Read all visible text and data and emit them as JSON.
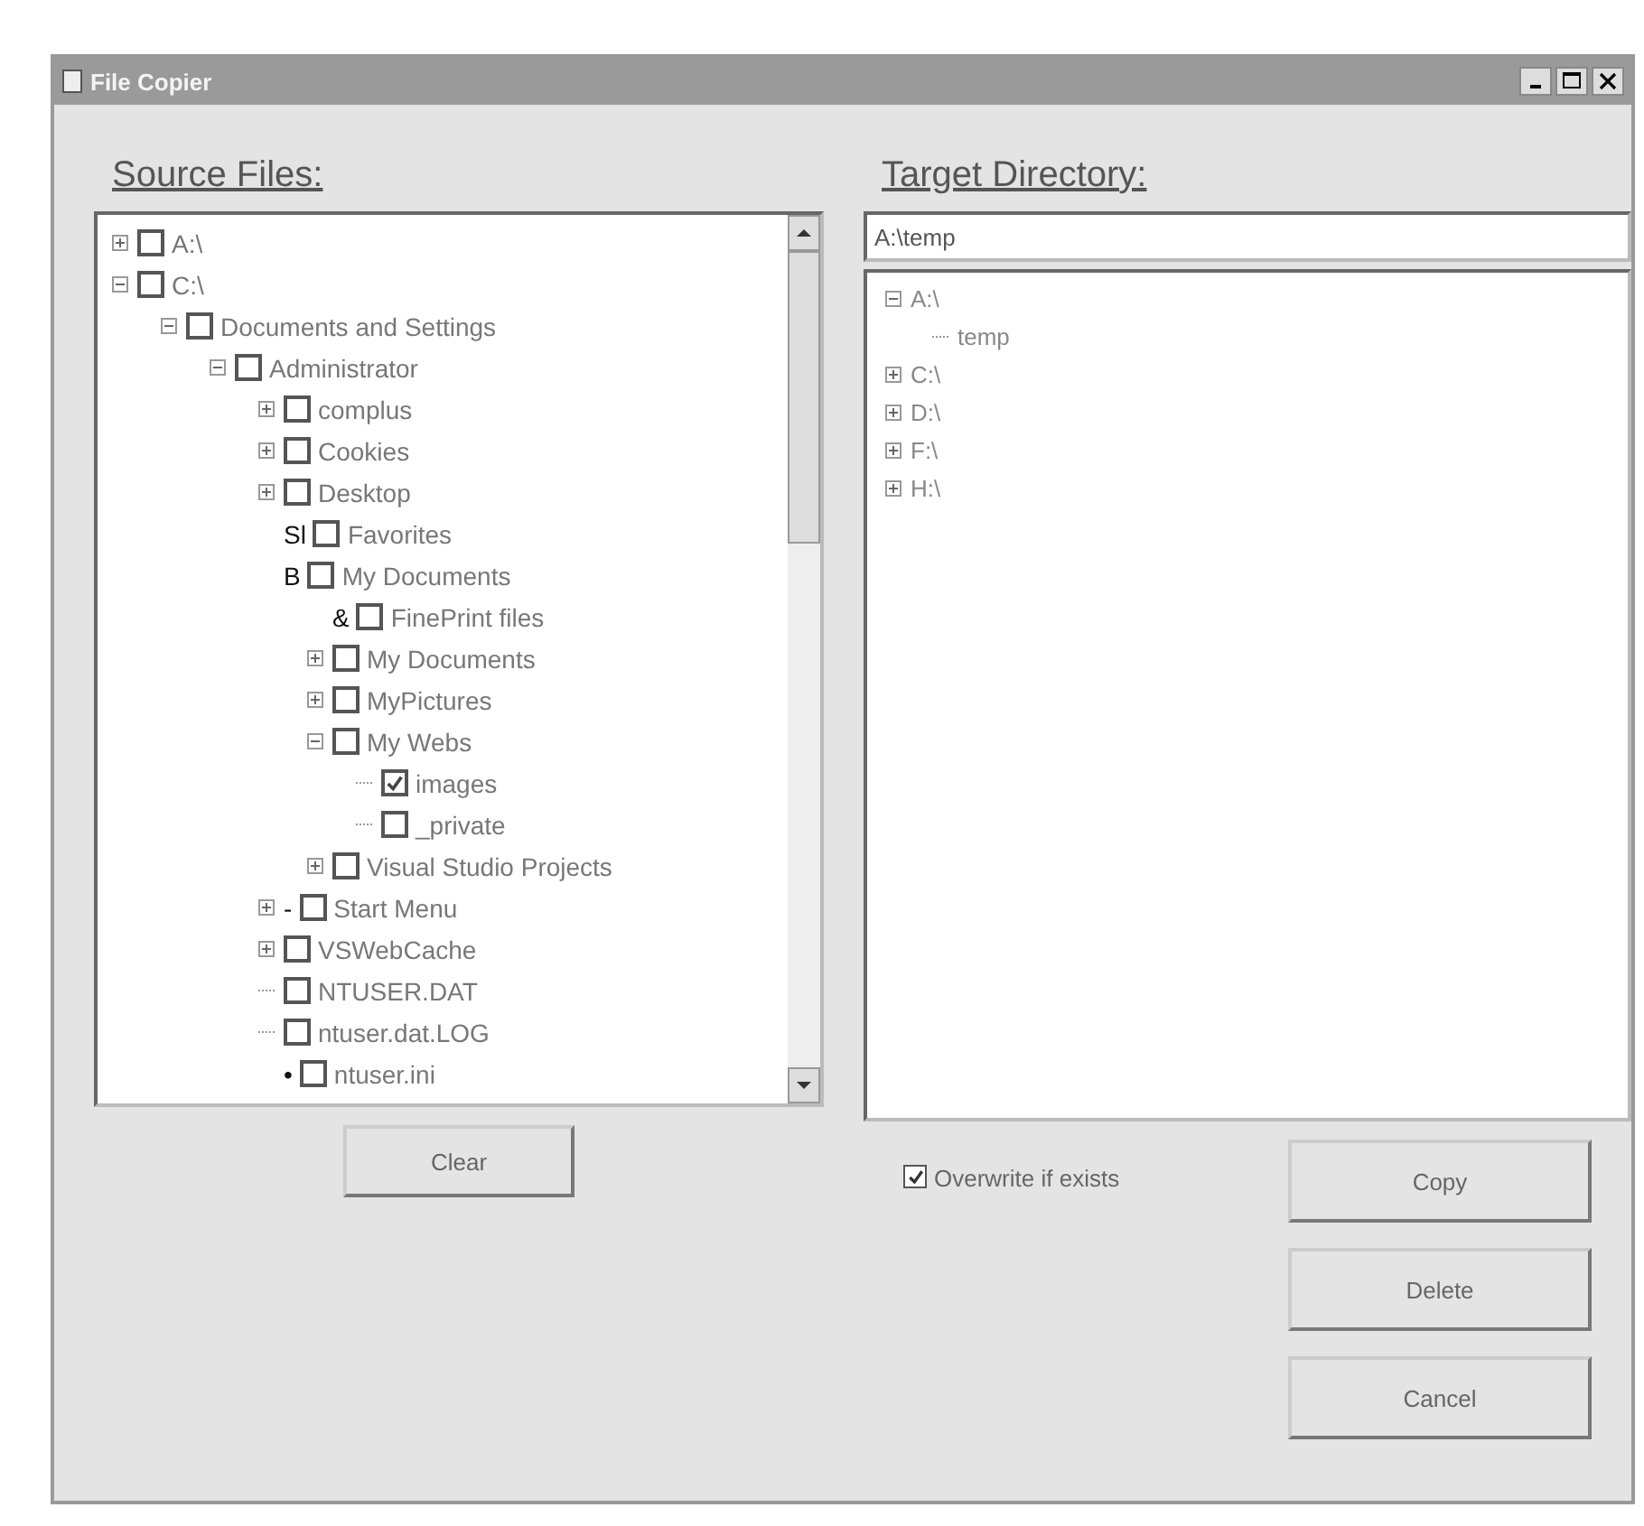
{
  "window": {
    "title": "File Copier"
  },
  "source": {
    "heading": "Source Files:",
    "tree": [
      {
        "label": "A:\\",
        "kind": "collapsed",
        "checked": false
      },
      {
        "label": "C:\\",
        "kind": "expanded",
        "checked": false,
        "children": [
          {
            "label": "Documents and Settings",
            "kind": "expanded",
            "checked": false,
            "children": [
              {
                "label": "Administrator",
                "kind": "expanded",
                "checked": false,
                "children": [
                  {
                    "label": "complus",
                    "kind": "collapsed",
                    "checked": false
                  },
                  {
                    "label": "Cookies",
                    "kind": "collapsed",
                    "checked": false
                  },
                  {
                    "label": "Desktop",
                    "kind": "collapsed",
                    "checked": false
                  },
                  {
                    "label": "Favorites",
                    "kind": "leaf",
                    "marker": "Sl",
                    "checked": false
                  },
                  {
                    "label": "My Documents",
                    "kind": "leaf",
                    "marker": "B",
                    "checked": false,
                    "children": [
                      {
                        "label": "FinePrint files",
                        "kind": "leaf",
                        "marker": "&",
                        "checked": false
                      },
                      {
                        "label": "My Documents",
                        "kind": "collapsed",
                        "checked": false
                      },
                      {
                        "label": "MyPictures",
                        "kind": "collapsed",
                        "checked": false
                      },
                      {
                        "label": "My Webs",
                        "kind": "expanded",
                        "checked": false,
                        "children": [
                          {
                            "label": "images",
                            "kind": "leaf",
                            "checked": true
                          },
                          {
                            "label": "_private",
                            "kind": "leaf",
                            "checked": false
                          }
                        ]
                      },
                      {
                        "label": "Visual Studio Projects",
                        "kind": "collapsed",
                        "checked": false
                      }
                    ]
                  },
                  {
                    "label": "Start Menu",
                    "kind": "collapsed",
                    "marker": "-",
                    "checked": false
                  },
                  {
                    "label": "VSWebCache",
                    "kind": "collapsed",
                    "checked": false
                  },
                  {
                    "label": "NTUSER.DAT",
                    "kind": "leaf",
                    "checked": false
                  },
                  {
                    "label": "ntuser.dat.LOG",
                    "kind": "leaf",
                    "checked": false
                  },
                  {
                    "label": "ntuser.ini",
                    "kind": "leaf",
                    "marker": "•",
                    "checked": false
                  }
                ]
              }
            ]
          }
        ]
      }
    ]
  },
  "target": {
    "heading": "Target Directory:",
    "path": "A:\\temp",
    "tree": [
      {
        "label": "A:\\",
        "kind": "expanded",
        "children": [
          {
            "label": "temp",
            "kind": "leaf"
          }
        ]
      },
      {
        "label": "C:\\",
        "kind": "collapsed"
      },
      {
        "label": "D:\\",
        "kind": "collapsed"
      },
      {
        "label": "F:\\",
        "kind": "collapsed"
      },
      {
        "label": "H:\\",
        "kind": "collapsed"
      }
    ]
  },
  "overwrite": {
    "label": "Overwrite if exists",
    "checked": true
  },
  "buttons": {
    "clear": "Clear",
    "actions": [
      "Copy",
      "Delete",
      "Cancel"
    ]
  }
}
